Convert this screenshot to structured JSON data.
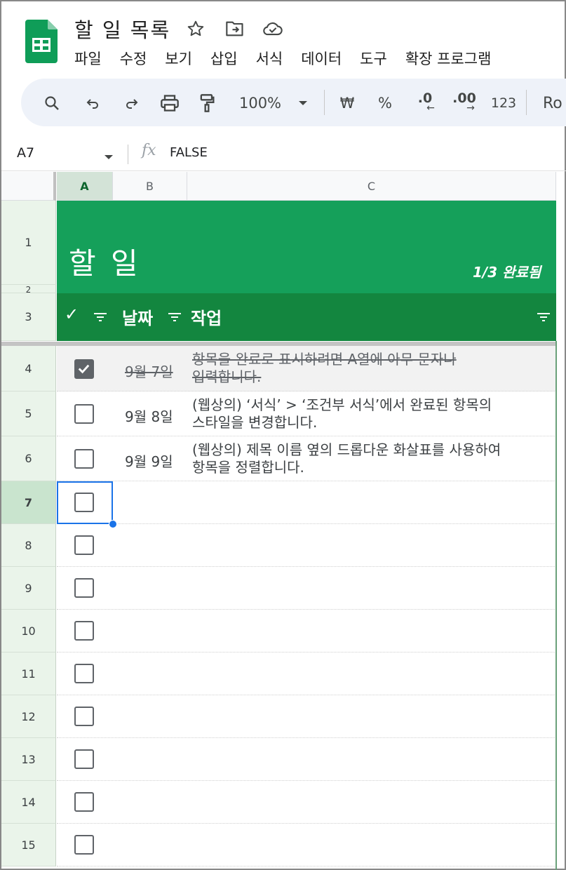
{
  "app": {
    "title": "할 일 목록",
    "menu": [
      "파일",
      "수정",
      "보기",
      "삽입",
      "서식",
      "데이터",
      "도구",
      "확장 프로그램"
    ]
  },
  "toolbar": {
    "zoom": "100%",
    "currency": "₩",
    "percent": "%",
    "decrease_decimal": ".0",
    "increase_decimal": ".00",
    "number_format": "123",
    "font": "Ro"
  },
  "formula_bar": {
    "cell_ref": "A7",
    "fx": "fx",
    "value": "FALSE"
  },
  "columns": [
    "A",
    "B",
    "C"
  ],
  "rows": [
    "1",
    "2",
    "3",
    "4",
    "5",
    "6",
    "7",
    "8",
    "9",
    "10",
    "11",
    "12",
    "13",
    "14",
    "15"
  ],
  "sheet": {
    "banner_title": "할 일",
    "completed_count": "1/3 완료됨",
    "header_check": "✓",
    "header_date": "날짜",
    "header_task": "작업",
    "tasks": [
      {
        "checked": true,
        "date": "9월 7일",
        "line1": "항목을 완료로 표시하려면 A열에 아무 문자나",
        "line2": "입력합니다."
      },
      {
        "checked": false,
        "date": "9월 8일",
        "line1": "(웹상의) ‘서식’ > ‘조건부 서식’에서 완료된 항목의",
        "line2": "스타일을 변경합니다."
      },
      {
        "checked": false,
        "date": "9월 9일",
        "line1": "(웹상의) 제목 이름 옆의 드롭다운 화살표를 사용하여",
        "line2": "항목을 정렬합니다."
      }
    ]
  },
  "colors": {
    "banner": "#15a05a",
    "header_row": "#13863f",
    "selection": "#1a73e8"
  }
}
